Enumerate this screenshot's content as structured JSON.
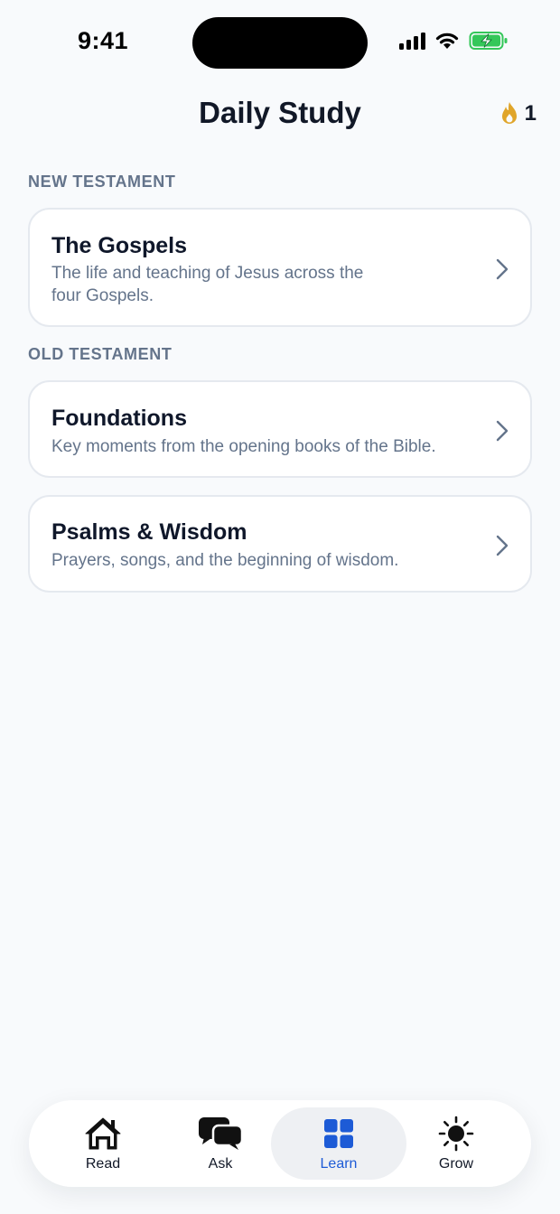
{
  "status_bar": {
    "time": "9:41",
    "icons": [
      "cellular-signal-icon",
      "wifi-icon",
      "battery-charging-icon"
    ]
  },
  "header": {
    "title": "Daily Study",
    "streak": {
      "icon": "flame-icon",
      "count": "1",
      "color": "#e0a52a"
    }
  },
  "sections": [
    {
      "label": "NEW TESTAMENT",
      "cards": [
        {
          "title": "The Gospels",
          "description": "The life and teaching of Jesus across the four Gospels."
        }
      ]
    },
    {
      "label": "OLD TESTAMENT",
      "cards": [
        {
          "title": "Foundations",
          "description": "Key moments from the opening books of the Bible."
        },
        {
          "title": "Psalms & Wisdom",
          "description": "Prayers, songs, and the beginning of wisdom."
        }
      ]
    }
  ],
  "tab_bar": {
    "active": "Learn",
    "accent_color": "#1d5bd6",
    "tabs": [
      {
        "label": "Read",
        "icon": "house-icon"
      },
      {
        "label": "Ask",
        "icon": "chat-bubbles-icon"
      },
      {
        "label": "Learn",
        "icon": "grid-icon"
      },
      {
        "label": "Grow",
        "icon": "sun-icon"
      }
    ]
  }
}
